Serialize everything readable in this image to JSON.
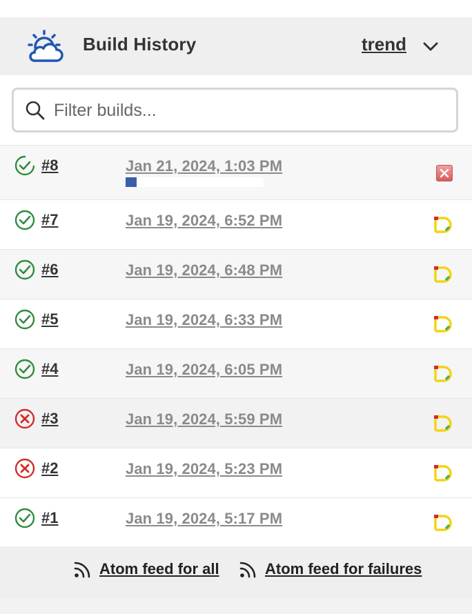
{
  "header": {
    "title": "Build History",
    "trend_label": "trend",
    "icons": {
      "weather": "sun-cloud-icon",
      "dropdown": "chevron-down-icon"
    }
  },
  "filter": {
    "placeholder": "Filter builds...",
    "value": "",
    "icon": "search-icon"
  },
  "builds": [
    {
      "number": "#8",
      "date": "Jan 21, 2024, 1:03 PM",
      "status": "success",
      "running": true,
      "progress": 0.08,
      "badge": "abort-icon"
    },
    {
      "number": "#7",
      "date": "Jan 19, 2024, 6:52 PM",
      "status": "success",
      "badge": "pipeline-icon"
    },
    {
      "number": "#6",
      "date": "Jan 19, 2024, 6:48 PM",
      "status": "success",
      "badge": "pipeline-icon"
    },
    {
      "number": "#5",
      "date": "Jan 19, 2024, 6:33 PM",
      "status": "success",
      "badge": "pipeline-icon"
    },
    {
      "number": "#4",
      "date": "Jan 19, 2024, 6:05 PM",
      "status": "success",
      "badge": "pipeline-icon"
    },
    {
      "number": "#3",
      "date": "Jan 19, 2024, 5:59 PM",
      "status": "failed",
      "badge": "pipeline-icon"
    },
    {
      "number": "#2",
      "date": "Jan 19, 2024, 5:23 PM",
      "status": "failed",
      "badge": "pipeline-icon"
    },
    {
      "number": "#1",
      "date": "Jan 19, 2024, 5:17 PM",
      "status": "success",
      "badge": "pipeline-icon"
    }
  ],
  "footer": {
    "feed_all": "Atom feed for all",
    "feed_failures": "Atom feed for failures",
    "icon": "rss-icon"
  },
  "colors": {
    "success": "#2e8b3e",
    "failed": "#d42a2a",
    "brand_blue": "#1f56b4",
    "progress": "#3a5ea8"
  }
}
